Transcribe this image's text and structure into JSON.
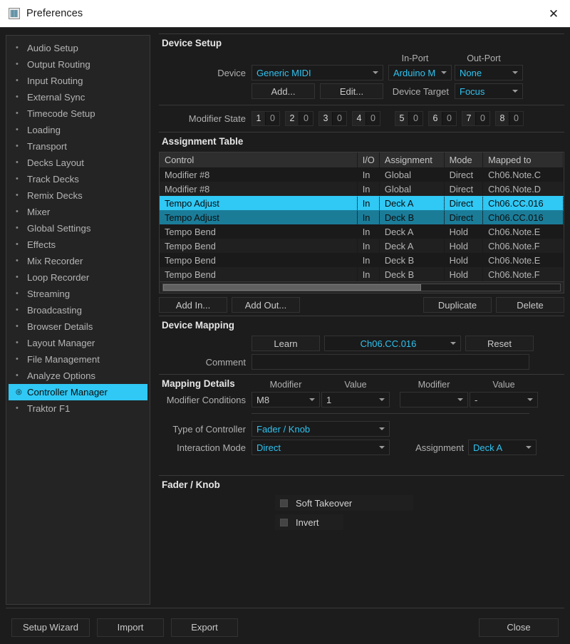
{
  "window": {
    "title": "Preferences",
    "icon": "preferences-icon",
    "close_label": "✕"
  },
  "sidebar": {
    "items": [
      {
        "label": "Audio Setup",
        "selected": false
      },
      {
        "label": "Output Routing",
        "selected": false
      },
      {
        "label": "Input Routing",
        "selected": false
      },
      {
        "label": "External Sync",
        "selected": false
      },
      {
        "label": "Timecode Setup",
        "selected": false
      },
      {
        "label": "Loading",
        "selected": false
      },
      {
        "label": "Transport",
        "selected": false
      },
      {
        "label": "Decks Layout",
        "selected": false
      },
      {
        "label": "Track Decks",
        "selected": false
      },
      {
        "label": "Remix Decks",
        "selected": false
      },
      {
        "label": "Mixer",
        "selected": false
      },
      {
        "label": "Global Settings",
        "selected": false
      },
      {
        "label": "Effects",
        "selected": false
      },
      {
        "label": "Mix Recorder",
        "selected": false
      },
      {
        "label": "Loop Recorder",
        "selected": false
      },
      {
        "label": "Streaming",
        "selected": false
      },
      {
        "label": "Broadcasting",
        "selected": false
      },
      {
        "label": "Browser Details",
        "selected": false
      },
      {
        "label": "Layout Manager",
        "selected": false
      },
      {
        "label": "File Management",
        "selected": false
      },
      {
        "label": "Analyze Options",
        "selected": false
      },
      {
        "label": "Controller Manager",
        "selected": true
      },
      {
        "label": "Traktor F1",
        "selected": false
      }
    ]
  },
  "device_setup": {
    "title": "Device Setup",
    "in_port_header": "In-Port",
    "out_port_header": "Out-Port",
    "device_label": "Device",
    "device_value": "Generic MIDI",
    "in_port_value": "Arduino M",
    "out_port_value": "None",
    "add_label": "Add...",
    "edit_label": "Edit...",
    "device_target_label": "Device Target",
    "device_target_value": "Focus",
    "modifier_state_label": "Modifier State",
    "modifier_states": [
      {
        "key": "1",
        "value": "0"
      },
      {
        "key": "2",
        "value": "0"
      },
      {
        "key": "3",
        "value": "0"
      },
      {
        "key": "4",
        "value": "0"
      },
      {
        "key": "5",
        "value": "0"
      },
      {
        "key": "6",
        "value": "0"
      },
      {
        "key": "7",
        "value": "0"
      },
      {
        "key": "8",
        "value": "0"
      }
    ]
  },
  "assignment_table": {
    "title": "Assignment Table",
    "columns": [
      "Control",
      "I/O",
      "Assignment",
      "Mode",
      "Mapped to"
    ],
    "rows": [
      {
        "control": "Modifier #8",
        "io": "In",
        "assignment": "Global",
        "mode": "Direct",
        "mapped_to": "Ch06.Note.C",
        "state": "normal"
      },
      {
        "control": "Modifier #8",
        "io": "In",
        "assignment": "Global",
        "mode": "Direct",
        "mapped_to": "Ch06.Note.D",
        "state": "normal"
      },
      {
        "control": "Tempo Adjust",
        "io": "In",
        "assignment": "Deck A",
        "mode": "Direct",
        "mapped_to": "Ch06.CC.016",
        "state": "selected-primary"
      },
      {
        "control": "Tempo Adjust",
        "io": "In",
        "assignment": "Deck B",
        "mode": "Direct",
        "mapped_to": "Ch06.CC.016",
        "state": "selected-secondary"
      },
      {
        "control": "Tempo Bend",
        "io": "In",
        "assignment": "Deck A",
        "mode": "Hold",
        "mapped_to": "Ch06.Note.E",
        "state": "normal"
      },
      {
        "control": "Tempo Bend",
        "io": "In",
        "assignment": "Deck A",
        "mode": "Hold",
        "mapped_to": "Ch06.Note.F",
        "state": "normal"
      },
      {
        "control": "Tempo Bend",
        "io": "In",
        "assignment": "Deck B",
        "mode": "Hold",
        "mapped_to": "Ch06.Note.E",
        "state": "normal"
      },
      {
        "control": "Tempo Bend",
        "io": "In",
        "assignment": "Deck B",
        "mode": "Hold",
        "mapped_to": "Ch06.Note.F",
        "state": "normal"
      }
    ],
    "scroll_percent": 65,
    "add_in_label": "Add In...",
    "add_out_label": "Add Out...",
    "duplicate_label": "Duplicate",
    "delete_label": "Delete"
  },
  "device_mapping": {
    "title": "Device Mapping",
    "learn_label": "Learn",
    "mapping_value": "Ch06.CC.016",
    "reset_label": "Reset",
    "comment_label": "Comment",
    "comment_value": ""
  },
  "mapping_details": {
    "title": "Mapping Details",
    "modifier_header_1": "Modifier",
    "value_header_1": "Value",
    "modifier_header_2": "Modifier",
    "value_header_2": "Value",
    "modifier_conditions_label": "Modifier Conditions",
    "modifier_1": "M8",
    "value_1": "1",
    "modifier_2": "",
    "value_2": "-",
    "type_of_controller_label": "Type of Controller",
    "type_of_controller_value": "Fader / Knob",
    "interaction_mode_label": "Interaction Mode",
    "interaction_mode_value": "Direct",
    "assignment_label": "Assignment",
    "assignment_value": "Deck A"
  },
  "fader_knob": {
    "title": "Fader / Knob",
    "soft_takeover_label": "Soft Takeover",
    "soft_takeover_checked": false,
    "invert_label": "Invert",
    "invert_checked": false
  },
  "footer": {
    "setup_wizard_label": "Setup Wizard",
    "import_label": "Import",
    "export_label": "Export",
    "close_label": "Close"
  },
  "colors": {
    "accent": "#30c8f4",
    "accent_dark": "#1b7c98",
    "panel_bg": "#1c1c1c",
    "control_bg": "#1a1a1a",
    "text": "#b6b6b6"
  }
}
